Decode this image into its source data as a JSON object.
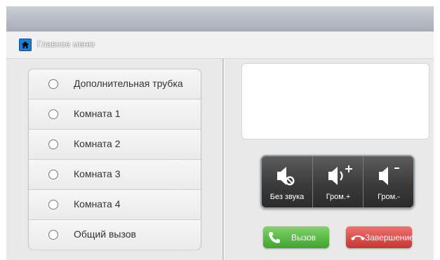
{
  "header": {
    "breadcrumb_label": "Главное меню",
    "icon": "home-icon"
  },
  "targets": {
    "items": [
      {
        "label": "Дополнительная трубка"
      },
      {
        "label": "Комната 1"
      },
      {
        "label": "Комната 2"
      },
      {
        "label": "Комната 3"
      },
      {
        "label": "Комната 4"
      },
      {
        "label": "Общий вызов"
      }
    ]
  },
  "audio": {
    "mute_label": "Без звука",
    "vol_up_label": "Гром.+",
    "vol_down_label": "Гром.-"
  },
  "actions": {
    "call_label": "Вызов",
    "hangup_label": "Завершение"
  },
  "colors": {
    "call": "#4fb83a",
    "hangup": "#e04744",
    "panel": "#3a3a3a",
    "accent": "#1d7bd8"
  }
}
